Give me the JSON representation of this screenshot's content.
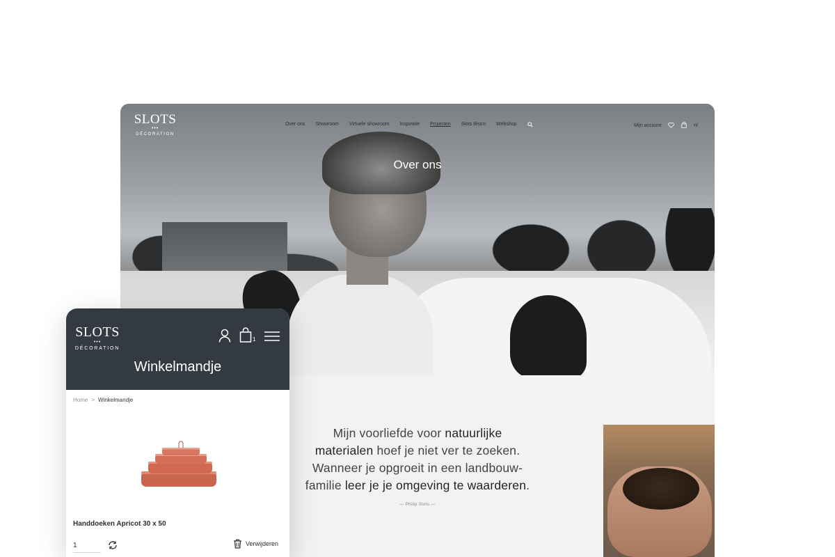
{
  "desktop": {
    "brand": {
      "name": "SLOTS",
      "dots": "•••",
      "sub": "DÉCORATION"
    },
    "nav": [
      {
        "label": "Over ons"
      },
      {
        "label": "Showroom"
      },
      {
        "label": "Virtuele showroom"
      },
      {
        "label": "Inspiratie"
      },
      {
        "label": "Projecten",
        "active": true
      },
      {
        "label": "Slots Bistro"
      },
      {
        "label": "Webshop"
      }
    ],
    "search_icon": "search-icon",
    "account_label": "Mijn account",
    "wishlist_icon": "heart-icon",
    "cart_icon": "bag-icon",
    "language": "nl",
    "hero_title": "Over ons",
    "quote": {
      "p1": "Mijn voorliefde voor ",
      "b1": "natuurlijke materialen",
      "p2": " hoef je niet ver te zoeken. Wanneer je opgroeit in een landbouw-familie ",
      "b2": "leer je je omgeving te waarderen",
      "p3": "."
    },
    "quote_author": "— Philip Slots —"
  },
  "mobile": {
    "brand": {
      "name": "SLOTS",
      "dots": "•••",
      "sub": "DÉCORATION"
    },
    "account_icon": "user-icon",
    "cart_icon": "bag-icon",
    "cart_count": "1",
    "menu_icon": "hamburger-icon",
    "page_title": "Winkelmandje",
    "breadcrumb": {
      "home": "Home",
      "separator": ">",
      "current": "Winkelmandje"
    },
    "product": {
      "name": "Handdoeken Apricot 30 x 50",
      "quantity": "1",
      "refresh_icon": "refresh-icon",
      "delete_icon": "trash-icon",
      "delete_label": "Verwijderen"
    }
  },
  "colors": {
    "mobile_header": "#343a42",
    "page_background": "#f3f2f2",
    "towel": "#d4705a"
  }
}
